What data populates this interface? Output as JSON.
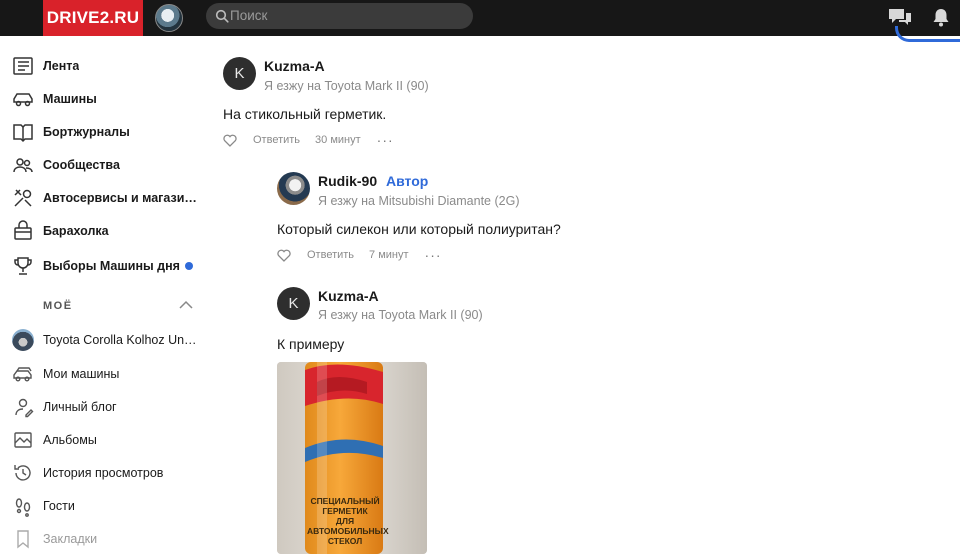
{
  "header": {
    "logo": "DRIVE2.RU",
    "search_placeholder": "Поиск"
  },
  "sidebar": {
    "items": [
      {
        "label": "Лента",
        "icon": "feed-icon"
      },
      {
        "label": "Машины",
        "icon": "car-icon"
      },
      {
        "label": "Бортжурналы",
        "icon": "logbook-icon"
      },
      {
        "label": "Сообщества",
        "icon": "communities-icon"
      },
      {
        "label": "Автосервисы и магазины",
        "icon": "tools-icon"
      },
      {
        "label": "Барахолка",
        "icon": "market-icon"
      },
      {
        "label": "Выборы Машины дня",
        "icon": "trophy-icon"
      }
    ],
    "section_title": "МОЁ",
    "my_items": [
      {
        "label": "Toyota Corolla Kolhoz Universal",
        "icon": "car-avatar"
      },
      {
        "label": "Мои машины",
        "icon": "cars-icon"
      },
      {
        "label": "Личный блог",
        "icon": "blog-icon"
      },
      {
        "label": "Альбомы",
        "icon": "albums-icon"
      },
      {
        "label": "История просмотров",
        "icon": "history-icon"
      },
      {
        "label": "Гости",
        "icon": "footprints-icon"
      },
      {
        "label": "Закладки",
        "icon": "bookmark-icon"
      }
    ]
  },
  "comments": [
    {
      "avatar_letter": "K",
      "name": "Kuzma-A",
      "car": "Я езжу на Toyota Mark II (90)",
      "text": "На стикольный герметик.",
      "reply": "Ответить",
      "time": "30 минут",
      "more": "···"
    },
    {
      "name": "Rudik-90",
      "badge": "Автор",
      "car": "Я езжу на Mitsubishi Diamante (2G)",
      "text": "Который силекон или который полиуритан?",
      "reply": "Ответить",
      "time": "7 минут",
      "more": "···"
    },
    {
      "avatar_letter": "K",
      "name": "Kuzma-A",
      "car": "Я езжу на Toyota Mark II (90)",
      "text": "К примеру",
      "photo_text": [
        "СПЕЦИАЛЬНЫЙ",
        "ГЕРМЕТИК",
        "ДЛЯ",
        "АВТОМОБИЛЬНЫХ",
        "СТЕКОЛ"
      ]
    }
  ],
  "colors": {
    "logo_bg": "#d9222a",
    "topbar_bg": "#171717",
    "accent": "#2f6ad9"
  }
}
